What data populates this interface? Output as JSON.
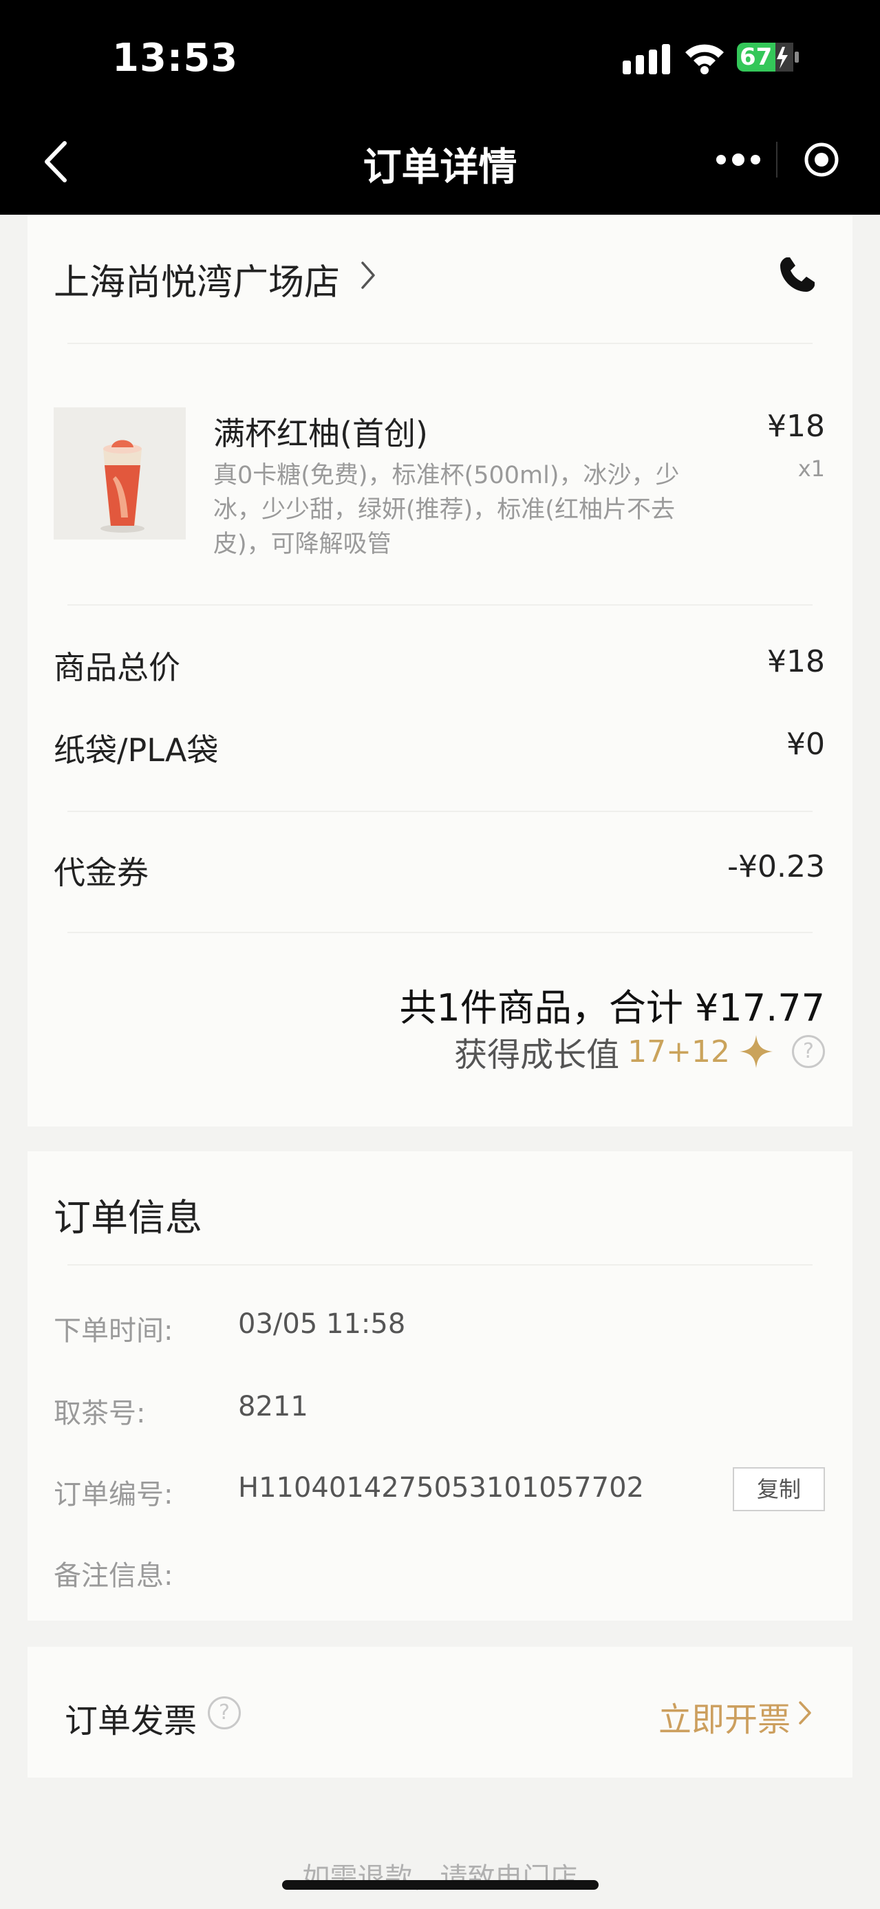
{
  "status": {
    "time": "13:53",
    "battery": "67"
  },
  "nav": {
    "title": "订单详情"
  },
  "store": {
    "name": "上海尚悦湾广场店"
  },
  "product": {
    "name": "满杯红柚(首创)",
    "options": "真0卡糖(免费)，标准杯(500ml)，冰沙，少冰，少少甜，绿妍(推荐)，标准(红柚片不去皮)，可降解吸管",
    "price": "¥18",
    "qty": "x1"
  },
  "summary": {
    "goods_label": "商品总价",
    "goods_value": "¥18",
    "bag_label": "纸袋/PLA袋",
    "bag_value": "¥0",
    "coupon_label": "代金券",
    "coupon_value": "-¥0.23",
    "total": "共1件商品，合计 ¥17.77",
    "growth_label": "获得成长值",
    "growth_value": "17+12"
  },
  "order_info": {
    "title": "订单信息",
    "rows": [
      {
        "label": "下单时间:",
        "value": "03/05 11:58"
      },
      {
        "label": "取茶号:",
        "value": "8211"
      },
      {
        "label": "订单编号:",
        "value": "H110401427505310105770​2"
      },
      {
        "label": "备注信息:",
        "value": ""
      }
    ],
    "copy_label": "复制"
  },
  "invoice": {
    "label": "订单发票",
    "action": "立即开票"
  },
  "footer": {
    "note": "如需退款，请致电门店"
  },
  "colors": {
    "accent_gold": "#cc9f5e",
    "growth_gold": "#caa35b",
    "header_bg": "#000000",
    "page_bg": "#f3f3f1"
  },
  "icons": [
    "back-arrow-icon",
    "more-dots-icon",
    "target-icon",
    "chevron-right-icon",
    "phone-icon",
    "star-icon",
    "question-icon"
  ]
}
